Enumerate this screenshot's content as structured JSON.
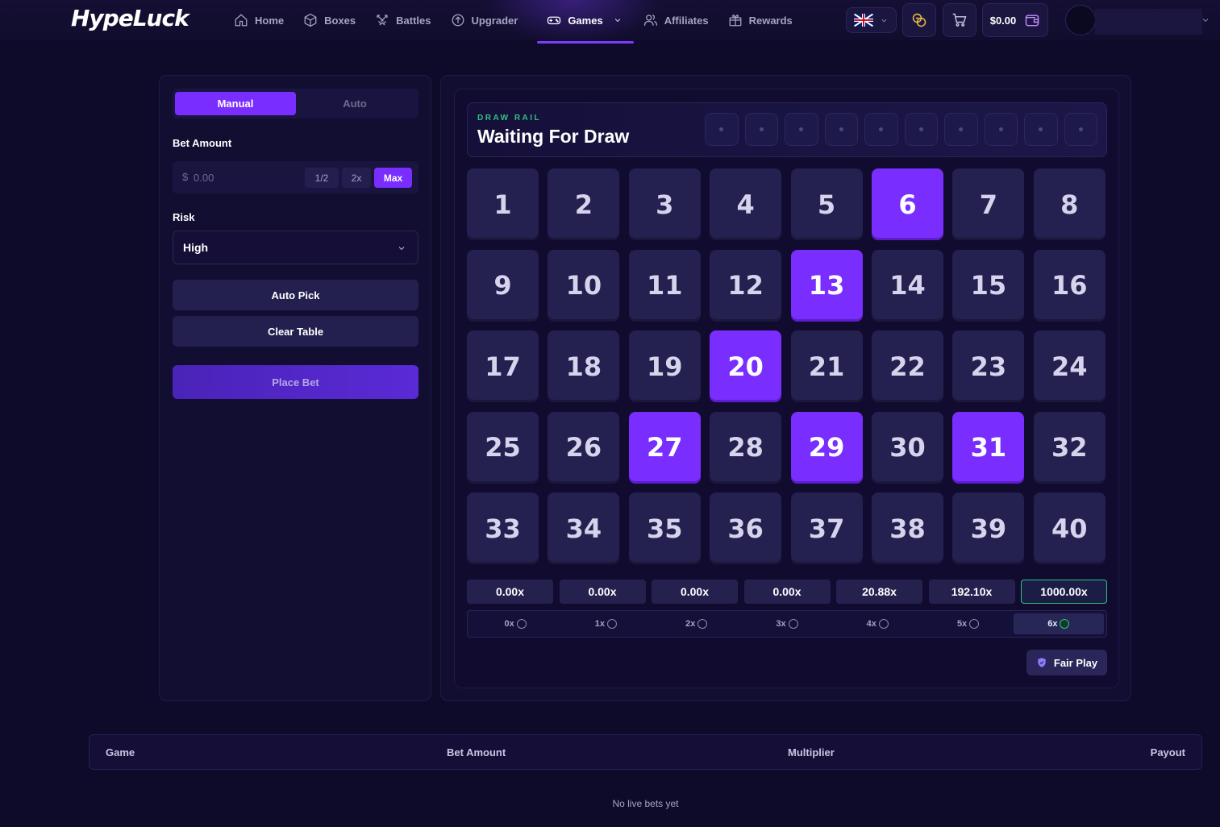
{
  "header": {
    "logo_text": "HypeLuck",
    "nav": [
      {
        "label": "Home",
        "icon": "home-icon"
      },
      {
        "label": "Boxes",
        "icon": "box-icon"
      },
      {
        "label": "Battles",
        "icon": "swords-icon"
      },
      {
        "label": "Upgrader",
        "icon": "arrow-up-circle-icon"
      },
      {
        "label": "Games",
        "icon": "gamepad-icon",
        "active": true
      },
      {
        "label": "Affiliates",
        "icon": "users-icon"
      },
      {
        "label": "Rewards",
        "icon": "gift-icon"
      }
    ],
    "language_flag": "uk-flag-icon",
    "balance": "$0.00"
  },
  "bet_panel": {
    "tabs": {
      "manual": "Manual",
      "auto": "Auto"
    },
    "active_tab": "Manual",
    "bet_amount_label": "Bet Amount",
    "bet_currency": "$",
    "bet_placeholder": "0.00",
    "half_label": "1/2",
    "double_label": "2x",
    "max_label": "Max",
    "risk_label": "Risk",
    "risk_value": "High",
    "auto_pick_label": "Auto Pick",
    "clear_table_label": "Clear Table",
    "place_bet_label": "Place Bet"
  },
  "draw_rail": {
    "kicker": "DRAW RAIL",
    "status": "Waiting For Draw",
    "slots": 10
  },
  "board": {
    "numbers": [
      "1",
      "2",
      "3",
      "4",
      "5",
      "6",
      "7",
      "8",
      "9",
      "10",
      "11",
      "12",
      "13",
      "14",
      "15",
      "16",
      "17",
      "18",
      "19",
      "20",
      "21",
      "22",
      "23",
      "24",
      "25",
      "26",
      "27",
      "28",
      "29",
      "30",
      "31",
      "32",
      "33",
      "34",
      "35",
      "36",
      "37",
      "38",
      "39",
      "40"
    ],
    "selected": [
      "6",
      "13",
      "20",
      "27",
      "29",
      "31"
    ]
  },
  "payouts": [
    "0.00x",
    "0.00x",
    "0.00x",
    "0.00x",
    "20.88x",
    "192.10x",
    "1000.00x"
  ],
  "highlighted_payout": "1000.00x",
  "hits": [
    "0x",
    "1x",
    "2x",
    "3x",
    "4x",
    "5x",
    "6x"
  ],
  "active_hit": "6x",
  "fair_play_label": "Fair Play",
  "live_bets": {
    "columns": [
      "Game",
      "Bet Amount",
      "Multiplier",
      "Payout"
    ],
    "empty_message": "No live bets yet"
  },
  "colors": {
    "accent": "#7a2dff",
    "background": "#0e0b2a",
    "success": "#2ec27e"
  }
}
